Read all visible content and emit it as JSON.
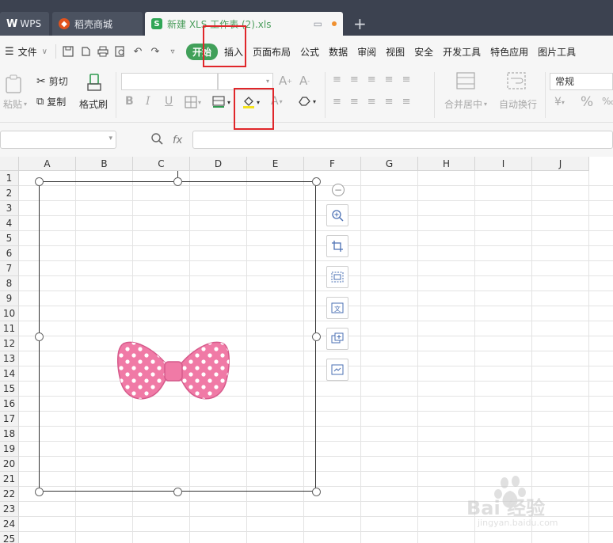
{
  "tabs": {
    "wps": "WPS",
    "store": "稻壳商城",
    "doc": "新建 XLS 工作表 (2).xls",
    "new_tab": "+"
  },
  "menu": {
    "file": "文件",
    "items": [
      "开始",
      "插入",
      "页面布局",
      "公式",
      "数据",
      "审阅",
      "视图",
      "安全",
      "开发工具",
      "特色应用",
      "图片工具"
    ]
  },
  "ribbon": {
    "paste": "粘贴",
    "cut": "剪切",
    "copy": "复制",
    "format_painter": "格式刷",
    "bold": "B",
    "italic": "I",
    "underline": "U",
    "merge_center": "合并居中",
    "wrap_text": "自动换行",
    "number_format": "常规",
    "percent": "%"
  },
  "formula_bar": {
    "fx": "fx"
  },
  "grid": {
    "columns": [
      "A",
      "B",
      "C",
      "D",
      "E",
      "F",
      "G",
      "H",
      "I",
      "J"
    ],
    "rows": [
      "1",
      "2",
      "3",
      "4",
      "5",
      "6",
      "7",
      "8",
      "9",
      "10",
      "11",
      "12",
      "13",
      "14",
      "15",
      "16",
      "17",
      "18",
      "19",
      "20",
      "21",
      "22",
      "23",
      "24",
      "25"
    ]
  },
  "colors": {
    "start_tab": "#41a05a",
    "highlight": "#e0262a",
    "bow": "#f07aa6"
  },
  "watermark": {
    "text": "Bai 经验",
    "url": "jingyan.baidu.com"
  }
}
